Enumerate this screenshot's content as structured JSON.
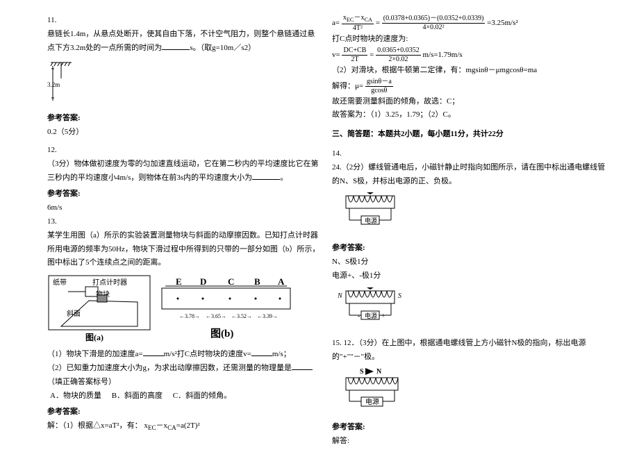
{
  "left": {
    "q11_num": "11.",
    "q11_text": "悬链长1.4m，从悬点处断开，使其自由下落，不计空气阻力，则整个悬链通过悬点下方3.2m处的一点所需的时间为",
    "q11_unit": "s。（取g=10m／s2）",
    "q11_len": "3.2m",
    "ans_label": "参考答案:",
    "q11_ans": "0.2（5分）",
    "q12_num": "12.",
    "q12_text": "（3分）物体做初速度为零的匀加速直线运动，它在第二秒内的平均速度比它在第三秒内的平均速度小4m/s，则物体在前3s内的平均速度大小为",
    "q12_end": "。",
    "q12_ans": "6m/s",
    "q13_num": "13.",
    "q13_p1": "某学生用图（a）所示的实验装置测量物块与斜面的动摩擦因数。已知打点计时器所用电源的频率为50Hz，物块下滑过程中所得到的只带的一部分如图（b）所示，图中标出了5个连续点之间的距离。",
    "label_tape": "纸带",
    "label_timer": "打点计时器",
    "label_block": "物块",
    "label_slope": "斜面",
    "fig_a": "图(a)",
    "fig_b": "图(b)",
    "pts": {
      "E": "E",
      "D": "D",
      "C": "C",
      "B": "B",
      "A": "A"
    },
    "dists": {
      "d1": "3.78",
      "d2": "3.65",
      "d3": "3.52",
      "d4": "3.39"
    },
    "q13_1": "（1）物块下滑是的加速度a=",
    "q13_1m": "m/s²打C点时物块的速度v=",
    "q13_1e": "m/s；",
    "q13_2": "（2）已知重力加速度大小为g，为求出动摩擦因数，还需测量的物理量是",
    "q13_2e": "（填正确答案标号）",
    "optA": "A．物块的质量",
    "optB": "B．斜面的高度",
    "optC": "C．斜面的倾角。",
    "sol_label": "解：（1）根据△x=aT²，有：",
    "sol_eq": "x",
    "sol_sub1": "EC",
    "sol_dash": "－x",
    "sol_sub2": "CA",
    "sol_eq2": "=a(2T)²"
  },
  "right": {
    "eq_a_lhs": "a=",
    "eq_a_num1": "x",
    "eq_a_sub1": "EC",
    "eq_a_mid": "－x",
    "eq_a_sub2": "CA",
    "eq_a_den1": "4T²",
    "eq_a_eq": "=",
    "eq_a_num2": "(0.0378+0.0365)－(0.0352+0.0339)",
    "eq_a_den2": "4×0.02²",
    "eq_a_res": "=3.25m/s²",
    "line_c": "打C点时物块的速度为:",
    "eq_v_lhs": "v=",
    "eq_v_num1": "DC+CB",
    "eq_v_den1": "2T",
    "eq_v_num2": "0.0365+0.0352",
    "eq_v_den2": "2×0.02",
    "eq_v_res": "m/s=1.79m/s",
    "line_2a": "（2）对滑块，根据牛顿第二定律，有：mgsinθ－μmgcosθ=ma",
    "mu_lhs": "解得：μ=",
    "mu_num": "gsinθ－a",
    "mu_den": "gcosθ",
    "line_need": "故还需要测量斜面的倾角，故选：C；",
    "line_ans": "故答案为：（1）3.25，1.79；（2）C。",
    "section3": "三、简答题：本题共2小题，每小题11分，共计22分",
    "q14_num": "14.",
    "q24_text": "24.（2分）螺线管通电后，小磁针静止时指向如图所示，请在图中标出通电螺线管的N、S极，并标出电源的正、负极。",
    "coil_N": "N",
    "coil_S": "S",
    "coil_src": "电源",
    "ans14_1": "N、S极1分",
    "ans14_2": "电源+、-极1分",
    "q15_text": "15. 12．（3分）在上图中，根据通电螺线管上方小磁针N极的指向，标出电源的\"+\"\"－\"极。",
    "jieda": "解答:"
  }
}
